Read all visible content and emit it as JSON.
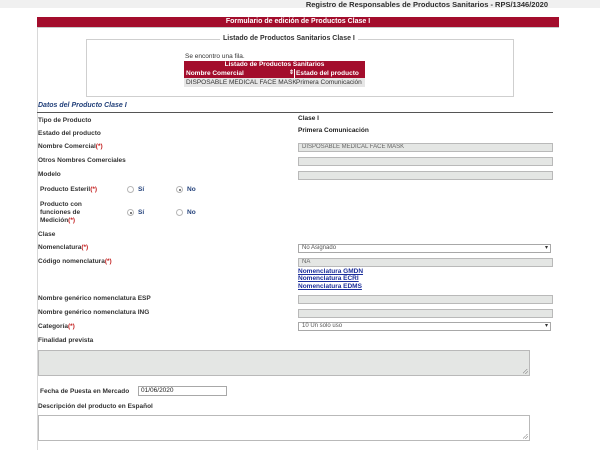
{
  "registry_title": "Registro de Responsables de Productos Sanitarios - RPS/1346/2020",
  "form_header": "Formulario de edición de Productos Clase I",
  "listing": {
    "legend": "Listado de Productos Sanitarios Clase I",
    "row_count_text": "Se encontro una fila.",
    "table_caption": "Listado de Productos Sanitarios",
    "columns": [
      "Nombre Comercial",
      "Estado del producto"
    ],
    "sort_icon": "sort-arrows-icon",
    "rows": [
      [
        "DISPOSABLE MEDICAL FACE MASK",
        "Primera Comunicación"
      ]
    ]
  },
  "section_title": "Datos del Producto Clase I",
  "fields": {
    "tipo_producto": {
      "label": "Tipo de Producto",
      "value": "Clase I"
    },
    "estado_producto": {
      "label": "Estado del producto",
      "value": "Primera Comunicación"
    },
    "nombre_comercial": {
      "label": "Nombre Comercial",
      "required": "(*)",
      "value": "DISPOSABLE MEDICAL FACE MASK"
    },
    "otros_nombres": {
      "label": "Otros Nombres Comerciales",
      "value": ""
    },
    "modelo": {
      "label": "Modelo",
      "value": ""
    },
    "producto_esteril": {
      "label": "Producto Esteril",
      "required": "(*)",
      "options": [
        "Sí",
        "No"
      ],
      "selected": "No"
    },
    "funciones_medicion": {
      "label_line1": "Producto con",
      "label_line2": "funciones de",
      "label_line3": "Medición",
      "required": "(*)",
      "options": [
        "Sí",
        "No"
      ],
      "selected": "Sí"
    },
    "clase": {
      "label": "Clase"
    },
    "nomenclatura": {
      "label": "Nomenclatura",
      "required": "(*)",
      "value": "No Asignado"
    },
    "codigo_nomenclatura": {
      "label": "Código nomenclatura",
      "required": "(*)",
      "value": "NA",
      "links": [
        "Nomenclatura GMDN",
        "Nomenclatura ECRI",
        "Nomenclatura EDMS"
      ]
    },
    "nombre_generico_esp": {
      "label": "Nombre genérico nomenclatura ESP",
      "value": ""
    },
    "nombre_generico_ing": {
      "label": "Nombre genérico nomenclatura ING",
      "value": ""
    },
    "categoria": {
      "label": "Categoría",
      "required": "(*)",
      "value": "10 Un solo uso"
    },
    "finalidad_prevista": {
      "label": "Finalidad prevista",
      "value": ""
    },
    "fecha_puesta_mercado": {
      "label": "Fecha de Puesta en Mercado",
      "value": "01/06/2020"
    },
    "descripcion_espanol": {
      "label": "Descripción del producto en Español",
      "value": ""
    }
  },
  "colors": {
    "header_red": "#a30d2c",
    "section_blue": "#22407a",
    "required_red": "#c21a1a",
    "link_blue": "#1a2d9a"
  }
}
